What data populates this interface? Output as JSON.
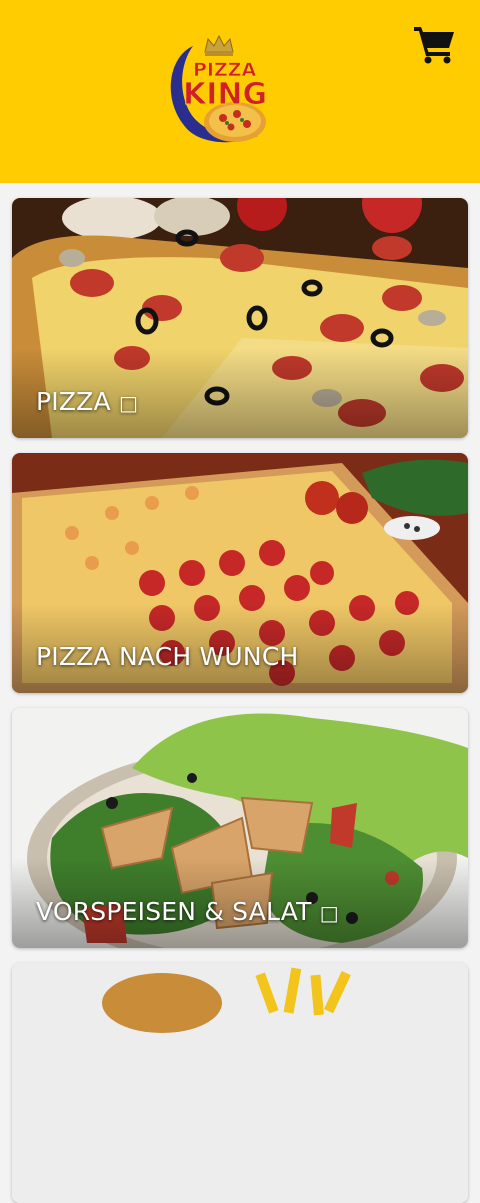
{
  "header": {
    "background": "#ffcc02",
    "logo": {
      "line1": "PIZZA",
      "line2": "KING"
    },
    "cart_icon": "shopping-cart-icon"
  },
  "categories": [
    {
      "label": "PIZZA",
      "arrow": "□"
    },
    {
      "label": "PIZZA NACH WUNCH",
      "arrow": ""
    },
    {
      "label": "VORSPEISEN & SALAT",
      "arrow": "□"
    },
    {
      "label": "",
      "arrow": ""
    }
  ]
}
